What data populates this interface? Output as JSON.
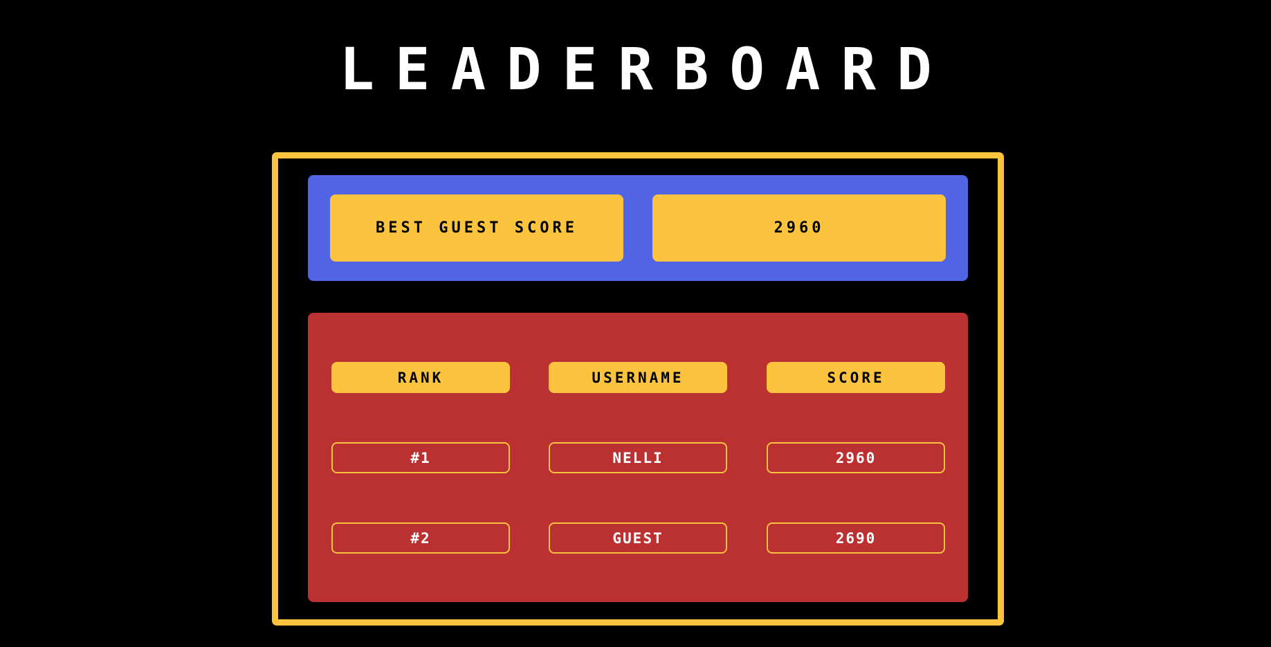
{
  "title": "LEADERBOARD",
  "colors": {
    "background": "#000000",
    "accent": "#fcc43e",
    "guest_panel": "#5064e4",
    "board_panel": "#bb3132"
  },
  "guest_score": {
    "label": "BEST GUEST SCORE",
    "value": "2960"
  },
  "leaderboard": {
    "headers": {
      "rank": "RANK",
      "username": "USERNAME",
      "score": "SCORE"
    },
    "rows": [
      {
        "rank": "#1",
        "username": "NELLI",
        "score": "2960"
      },
      {
        "rank": "#2",
        "username": "GUEST",
        "score": "2690"
      }
    ]
  }
}
